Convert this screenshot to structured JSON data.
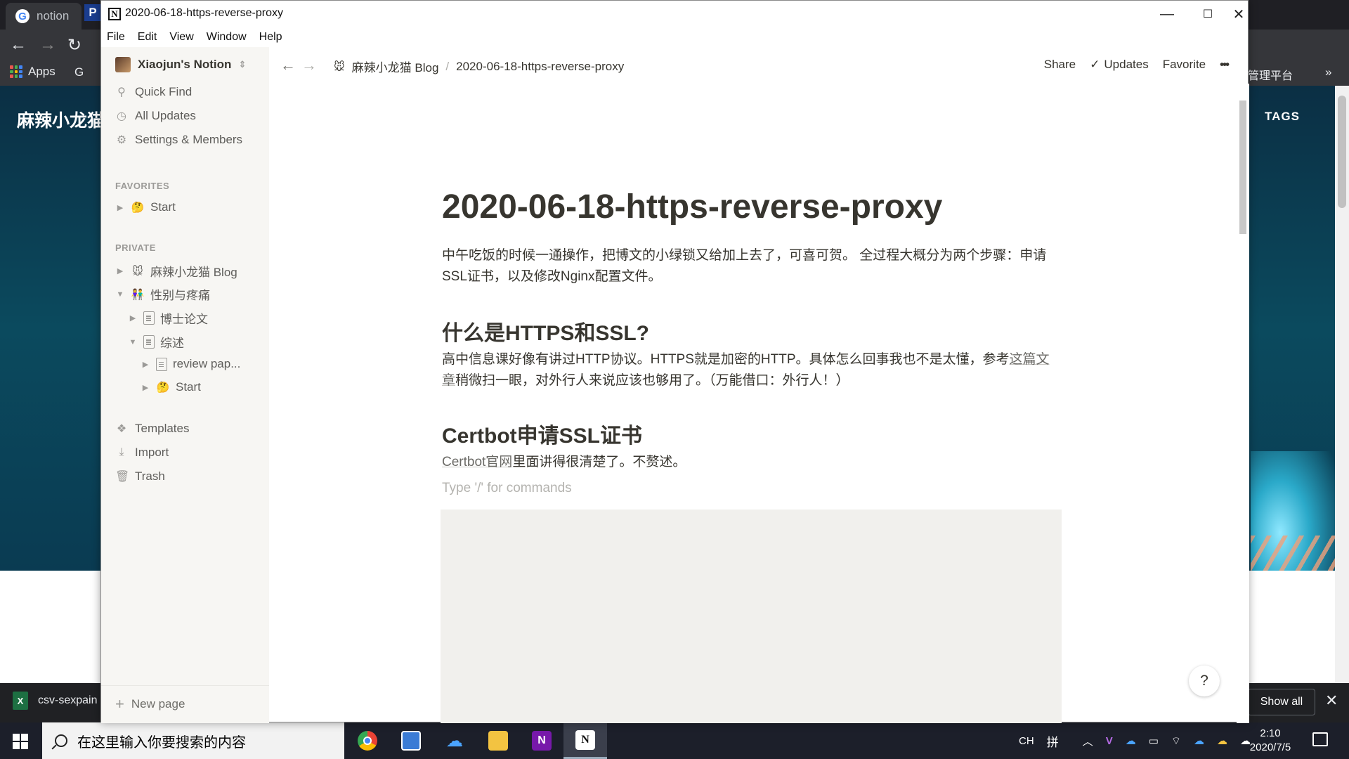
{
  "background_browser": {
    "tab1_label": "notion",
    "tab2_label": "P",
    "bookmarks_apps": "Apps",
    "bookmarks_g": "G",
    "site_title": "麻辣小龙猫",
    "tags_label": "TAGS",
    "right_text": "管理平台",
    "more": "»"
  },
  "download_bar": {
    "file_name": "csv-sexpain",
    "show_all": "Show all"
  },
  "taskbar": {
    "search_placeholder": "在这里输入你要搜索的内容",
    "ime_lang": "CH",
    "ime_mode": "拼",
    "time": "2:10",
    "date": "2020/7/5"
  },
  "window": {
    "title": "2020-06-18-https-reverse-proxy",
    "menu": [
      "File",
      "Edit",
      "View",
      "Window",
      "Help"
    ]
  },
  "sidebar": {
    "workspace": "Xiaojun's Notion",
    "quick_find": "Quick Find",
    "all_updates": "All Updates",
    "settings": "Settings & Members",
    "favorites_heading": "FAVORITES",
    "favorites": [
      {
        "emoji": "🤔",
        "label": "Start"
      }
    ],
    "private_heading": "PRIVATE",
    "private": [
      {
        "emoji": "🐭",
        "label": "麻辣小龙猫 Blog"
      },
      {
        "emoji": "👫",
        "label": "性别与疼痛"
      },
      {
        "emoji": "",
        "label": "博士论文"
      },
      {
        "emoji": "",
        "label": "综述"
      },
      {
        "emoji": "",
        "label": "review pap..."
      },
      {
        "emoji": "🤔",
        "label": "Start"
      }
    ],
    "templates": "Templates",
    "import": "Import",
    "trash": "Trash",
    "new_page": "New page"
  },
  "topbar": {
    "crumb_parent_emoji": "🐭",
    "crumb_parent": "麻辣小龙猫 Blog",
    "crumb_sep": "/",
    "crumb_current": "2020-06-18-https-reverse-proxy",
    "share": "Share",
    "updates": "Updates",
    "favorite": "Favorite",
    "more": "•••"
  },
  "page": {
    "title": "2020-06-18-https-reverse-proxy",
    "intro": "中午吃饭的时候一通操作，把博文的小绿锁又给加上去了，可喜可贺。 全过程大概分为两个步骤：申请SSL证书，以及修改Nginx配置文件。",
    "h_https": "什么是HTTPS和SSL?",
    "https_text_before": "高中信息课好像有讲过HTTP协议。HTTPS就是加密的HTTP。具体怎么回事我也不是太懂，参考",
    "https_link": "这篇文章",
    "https_text_after": "稍微扫一眼，对外行人来说应该也够用了。（万能借口：外行人！）",
    "h_certbot": "Certbot申请SSL证书",
    "certbot_link": "Certbot官网",
    "certbot_text": "里面讲得很清楚了。不赘述。",
    "placeholder": "Type '/' for commands",
    "help": "?"
  }
}
